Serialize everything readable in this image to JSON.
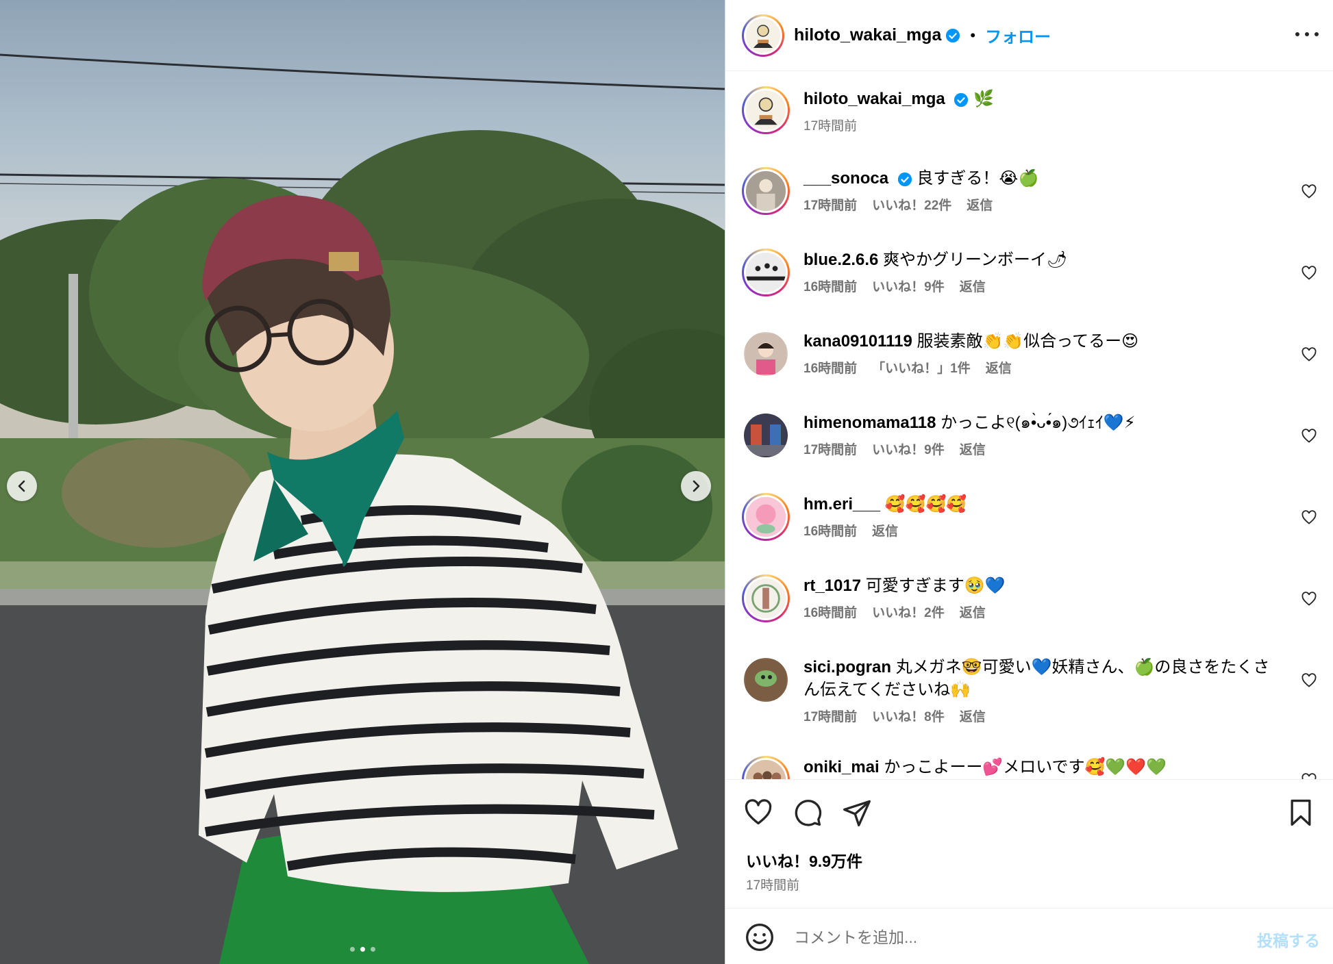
{
  "post": {
    "username": "hiloto_wakai_mga",
    "follow_separator": "•",
    "follow_label": "フォロー",
    "caption_emoji": "🌿",
    "caption_time": "17時間前",
    "likes": "いいね！9.9万件",
    "time": "17時間前"
  },
  "carousel": {
    "image_count": 3,
    "active_index": 1
  },
  "comments": [
    {
      "user": "___sonoca",
      "verified": true,
      "text": "良すぎる！😭🍏",
      "time": "17時間前",
      "likes": "いいね！22件",
      "reply": "返信"
    },
    {
      "user": "blue.2.6.6",
      "verified": false,
      "text": "爽やかグリーンボーイ🌶",
      "time": "16時間前",
      "likes": "いいね！9件",
      "reply": "返信"
    },
    {
      "user": "kana09101119",
      "verified": false,
      "text": "服装素敵👏👏似合ってるー😍",
      "time": "16時間前",
      "likes": "「いいね！」1件",
      "reply": "返信"
    },
    {
      "user": "himenomama118",
      "verified": false,
      "text": "かっこよ୧(๑•̀ᴗ•́๑)૭ｲｪｲ💙⚡",
      "time": "17時間前",
      "likes": "いいね！9件",
      "reply": "返信"
    },
    {
      "user": "hm.eri___",
      "verified": false,
      "text": "🥰🥰🥰🥰",
      "time": "16時間前",
      "likes": "",
      "reply": "返信"
    },
    {
      "user": "rt_1017",
      "verified": false,
      "text": "可愛すぎます🥹💙",
      "time": "16時間前",
      "likes": "いいね！2件",
      "reply": "返信"
    },
    {
      "user": "sici.pogran",
      "verified": false,
      "text": "丸メガネ🤓可愛い💙妖精さん、🍏の良さをたくさん伝えてくださいね🙌",
      "time": "17時間前",
      "likes": "いいね！8件",
      "reply": "返信"
    },
    {
      "user": "oniki_mai",
      "verified": false,
      "text": "かっこよーー💕メロいです🥰💚❤️💚",
      "time": "",
      "likes": "",
      "reply": ""
    }
  ],
  "composer": {
    "placeholder": "コメントを追加...",
    "post_label": "投稿する"
  },
  "colors": {
    "link_blue": "#0095f6",
    "verified_blue": "#0095f6",
    "meta_gray": "#737373",
    "post_button_disabled": "#b2dffc"
  },
  "icons": [
    "heart-icon",
    "comment-icon",
    "share-icon",
    "bookmark-icon",
    "emoji-icon",
    "more-icon",
    "chevron-left-icon",
    "chevron-right-icon",
    "verified-icon"
  ]
}
